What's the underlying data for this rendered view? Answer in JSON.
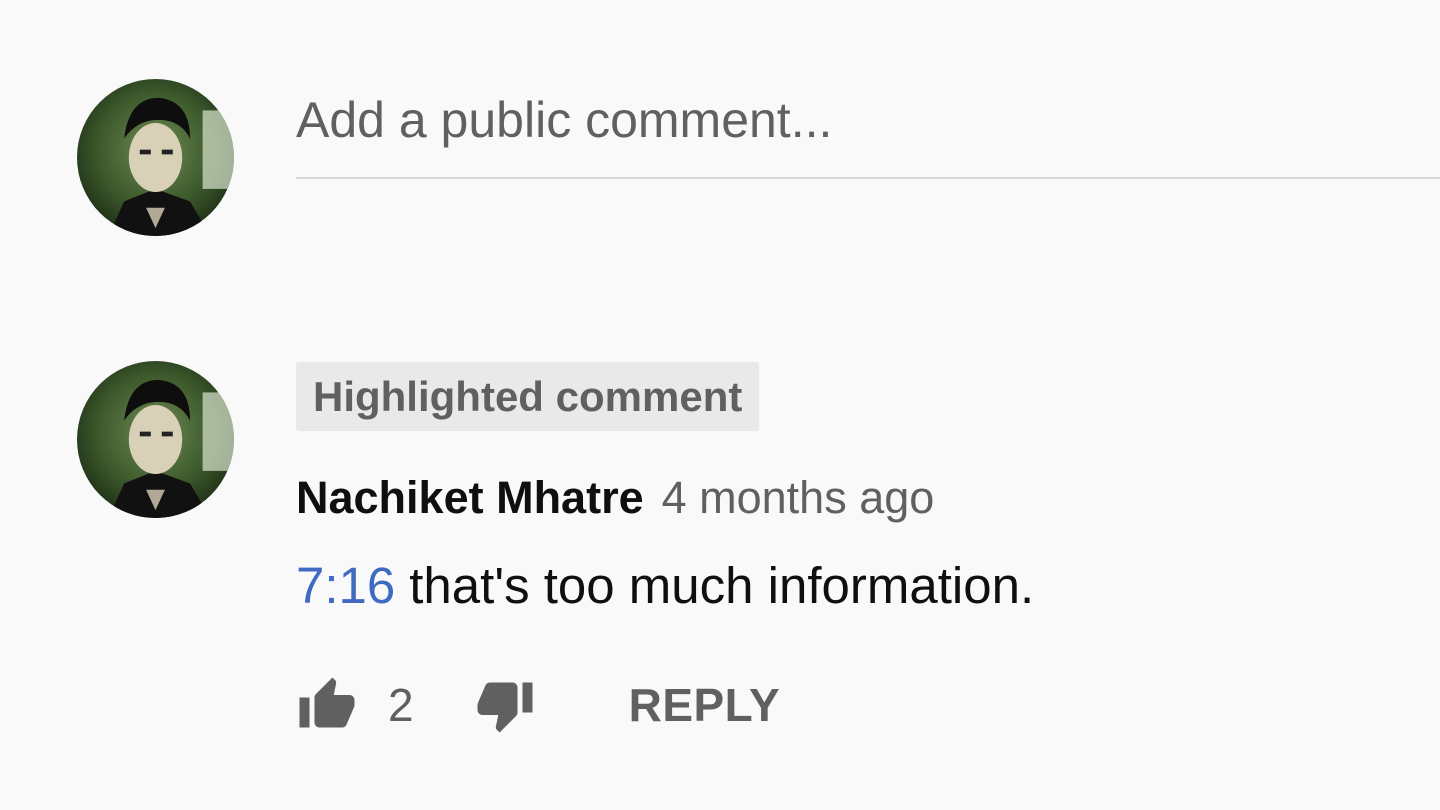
{
  "composer": {
    "placeholder": "Add a public comment..."
  },
  "comment": {
    "badge": "Highlighted comment",
    "author": "Nachiket Mhatre",
    "time": "4 months ago",
    "timestamp_link": "7:16",
    "text": "that's too much information.",
    "like_count": "2",
    "reply_label": "REPLY"
  },
  "icons": {
    "like": "thumbs-up-icon",
    "dislike": "thumbs-down-icon"
  },
  "colors": {
    "background": "#f9f9f9",
    "link": "#3e6ac1",
    "secondary_text": "#606060",
    "primary_text": "#0f0f0f",
    "badge_bg": "#e9e9e9"
  }
}
